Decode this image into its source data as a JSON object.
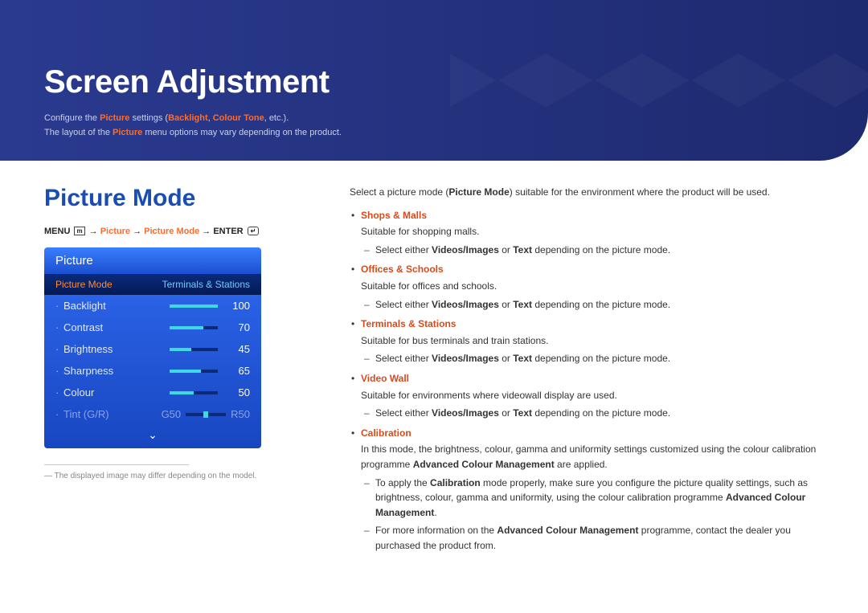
{
  "banner": {
    "title": "Screen Adjustment",
    "desc1_a": "Configure the ",
    "desc1_b": "Picture",
    "desc1_c": " settings (",
    "desc1_d": "Backlight",
    "desc1_e": ", ",
    "desc1_f": "Colour Tone",
    "desc1_g": ", etc.).",
    "desc2_a": "The layout of the ",
    "desc2_b": "Picture",
    "desc2_c": " menu options may vary depending on the product."
  },
  "section_title": "Picture Mode",
  "breadcrumb": {
    "menu": "MENU",
    "menu_icon": "m",
    "arrow": "→",
    "p1": "Picture",
    "p2": "Picture Mode",
    "enter": "ENTER",
    "enter_icon": "↵"
  },
  "osd": {
    "title": "Picture",
    "header_left": "Picture Mode",
    "header_right": "Terminals & Stations",
    "rows": [
      {
        "label": "Backlight",
        "value": "100",
        "pct": 100
      },
      {
        "label": "Contrast",
        "value": "70",
        "pct": 70
      },
      {
        "label": "Brightness",
        "value": "45",
        "pct": 45
      },
      {
        "label": "Sharpness",
        "value": "65",
        "pct": 65
      },
      {
        "label": "Colour",
        "value": "50",
        "pct": 50
      }
    ],
    "tint": {
      "label": "Tint (G/R)",
      "g": "G50",
      "r": "R50"
    }
  },
  "footnote": "The displayed image may differ depending on the model.",
  "intro_a": "Select a picture mode (",
  "intro_b": "Picture Mode",
  "intro_c": ") suitable for the environment where the product will be used.",
  "vi_prefix": "Select either ",
  "vi_a": "Videos/Images",
  "vi_mid": " or ",
  "vi_b": "Text",
  "vi_suffix": " depending on the picture mode.",
  "modes": {
    "shops": {
      "name": "Shops & Malls",
      "desc": "Suitable for shopping malls."
    },
    "offices": {
      "name": "Offices & Schools",
      "desc": "Suitable for offices and schools."
    },
    "terminals": {
      "name": "Terminals & Stations",
      "desc": "Suitable for bus terminals and train stations."
    },
    "videowall": {
      "name": "Video Wall",
      "desc": "Suitable for environments where videowall display are used."
    },
    "calib": {
      "name": "Calibration",
      "desc_a": "In this mode, the brightness, colour, gamma and uniformity settings customized using the colour calibration programme ",
      "desc_b": "Advanced Colour Management",
      "desc_c": " are applied.",
      "sub1_a": "To apply the ",
      "sub1_b": "Calibration",
      "sub1_c": " mode properly, make sure you configure the picture quality settings, such as brightness, colour, gamma and uniformity, using the colour calibration programme ",
      "sub1_d": "Advanced Colour Management",
      "sub1_e": ".",
      "sub2_a": "For more information on the ",
      "sub2_b": "Advanced Colour Management",
      "sub2_c": " programme, contact the dealer you purchased the product from."
    }
  }
}
